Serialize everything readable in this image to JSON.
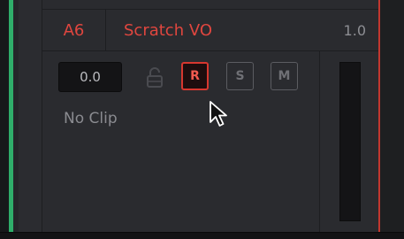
{
  "track": {
    "id": "A6",
    "name": "Scratch VO",
    "volume": "1.0",
    "level": "0.0",
    "clip_status": "No Clip"
  },
  "buttons": {
    "record": "R",
    "solo": "S",
    "mute": "M"
  },
  "states": {
    "record_armed": true,
    "solo_on": false,
    "mute_on": false,
    "locked": false
  },
  "colors": {
    "accent_red": "#e0463f",
    "track_color_green": "#2fae6a",
    "playhead": "#c2372f"
  },
  "icons": {
    "lock": "lock-icon",
    "cursor": "mouse-pointer-icon"
  }
}
